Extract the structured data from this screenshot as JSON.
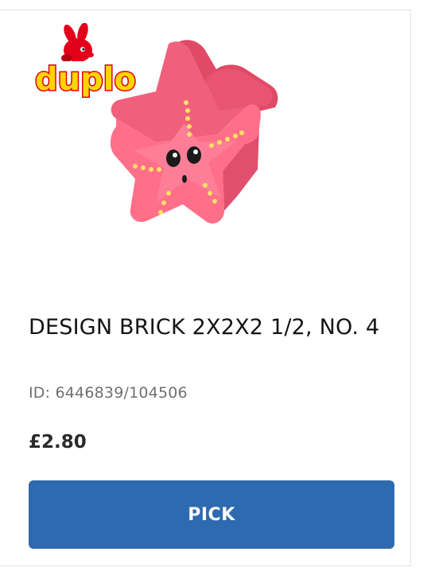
{
  "product": {
    "brand_logo": "duplo",
    "image_icon": "starfish-brick-image",
    "title": "DESIGN BRICK 2X2X2 1/2, NO. 4",
    "id_text": "ID: 6446839/104506",
    "price": "£2.80"
  },
  "actions": {
    "pick_label": "PICK"
  },
  "colors": {
    "brick": "#f0607c",
    "button": "#2e6ab0",
    "logo_red": "#e2001a",
    "logo_yellow": "#ffd500"
  }
}
